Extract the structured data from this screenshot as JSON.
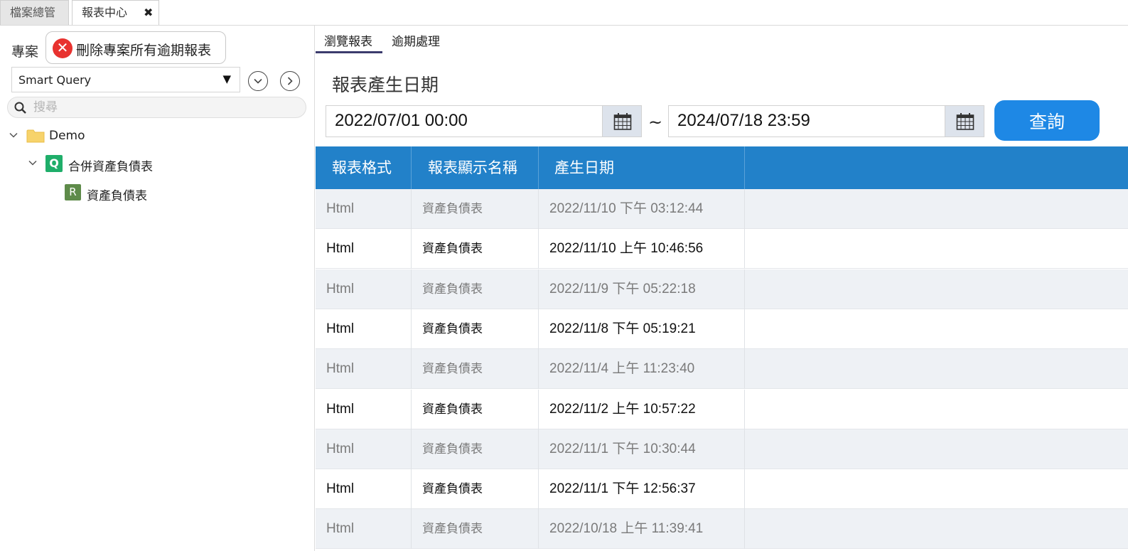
{
  "top_tabs": [
    {
      "label": "檔案總管"
    },
    {
      "label": "報表中心",
      "close_glyph": "✖"
    }
  ],
  "left_panel": {
    "project_label": "專案",
    "delete_button_label": "刪除專案所有逾期報表",
    "project_select_value": "Smart Query",
    "search_placeholder": "搜尋",
    "tree": [
      {
        "label": "Demo",
        "icon": "folder-icon"
      },
      {
        "label": "合併資產負債表",
        "badge": "Q"
      },
      {
        "label": "資產負債表",
        "badge": "R"
      }
    ]
  },
  "right_panel": {
    "sub_tabs": [
      {
        "label": "瀏覽報表"
      },
      {
        "label": "逾期處理"
      }
    ],
    "section_title": "報表產生日期",
    "date_from": "2022/07/01 00:00",
    "date_to": "2024/07/18 23:59",
    "range_separator": "~",
    "query_button_label": "查詢",
    "table": {
      "headers": [
        "報表格式",
        "報表顯示名稱",
        "產生日期"
      ],
      "rows": [
        [
          "Html",
          "資產負債表",
          "2022/11/10 下午 03:12:44"
        ],
        [
          "Html",
          "資產負債表",
          "2022/11/10 上午 10:46:56"
        ],
        [
          "Html",
          "資產負債表",
          "2022/11/9 下午 05:22:18"
        ],
        [
          "Html",
          "資產負債表",
          "2022/11/8 下午 05:19:21"
        ],
        [
          "Html",
          "資產負債表",
          "2022/11/4 上午 11:23:40"
        ],
        [
          "Html",
          "資產負債表",
          "2022/11/2 上午 10:57:22"
        ],
        [
          "Html",
          "資產負債表",
          "2022/11/1 下午 10:30:44"
        ],
        [
          "Html",
          "資產負債表",
          "2022/11/1 下午 12:56:37"
        ],
        [
          "Html",
          "資產負債表",
          "2022/10/18 上午 11:39:41"
        ]
      ]
    }
  },
  "colors": {
    "accent": "#1e88e5",
    "grid_header": "#2281c9",
    "delete_icon": "#e8322f",
    "q_badge": "#1fae6a",
    "r_badge": "#5e8b4a"
  }
}
